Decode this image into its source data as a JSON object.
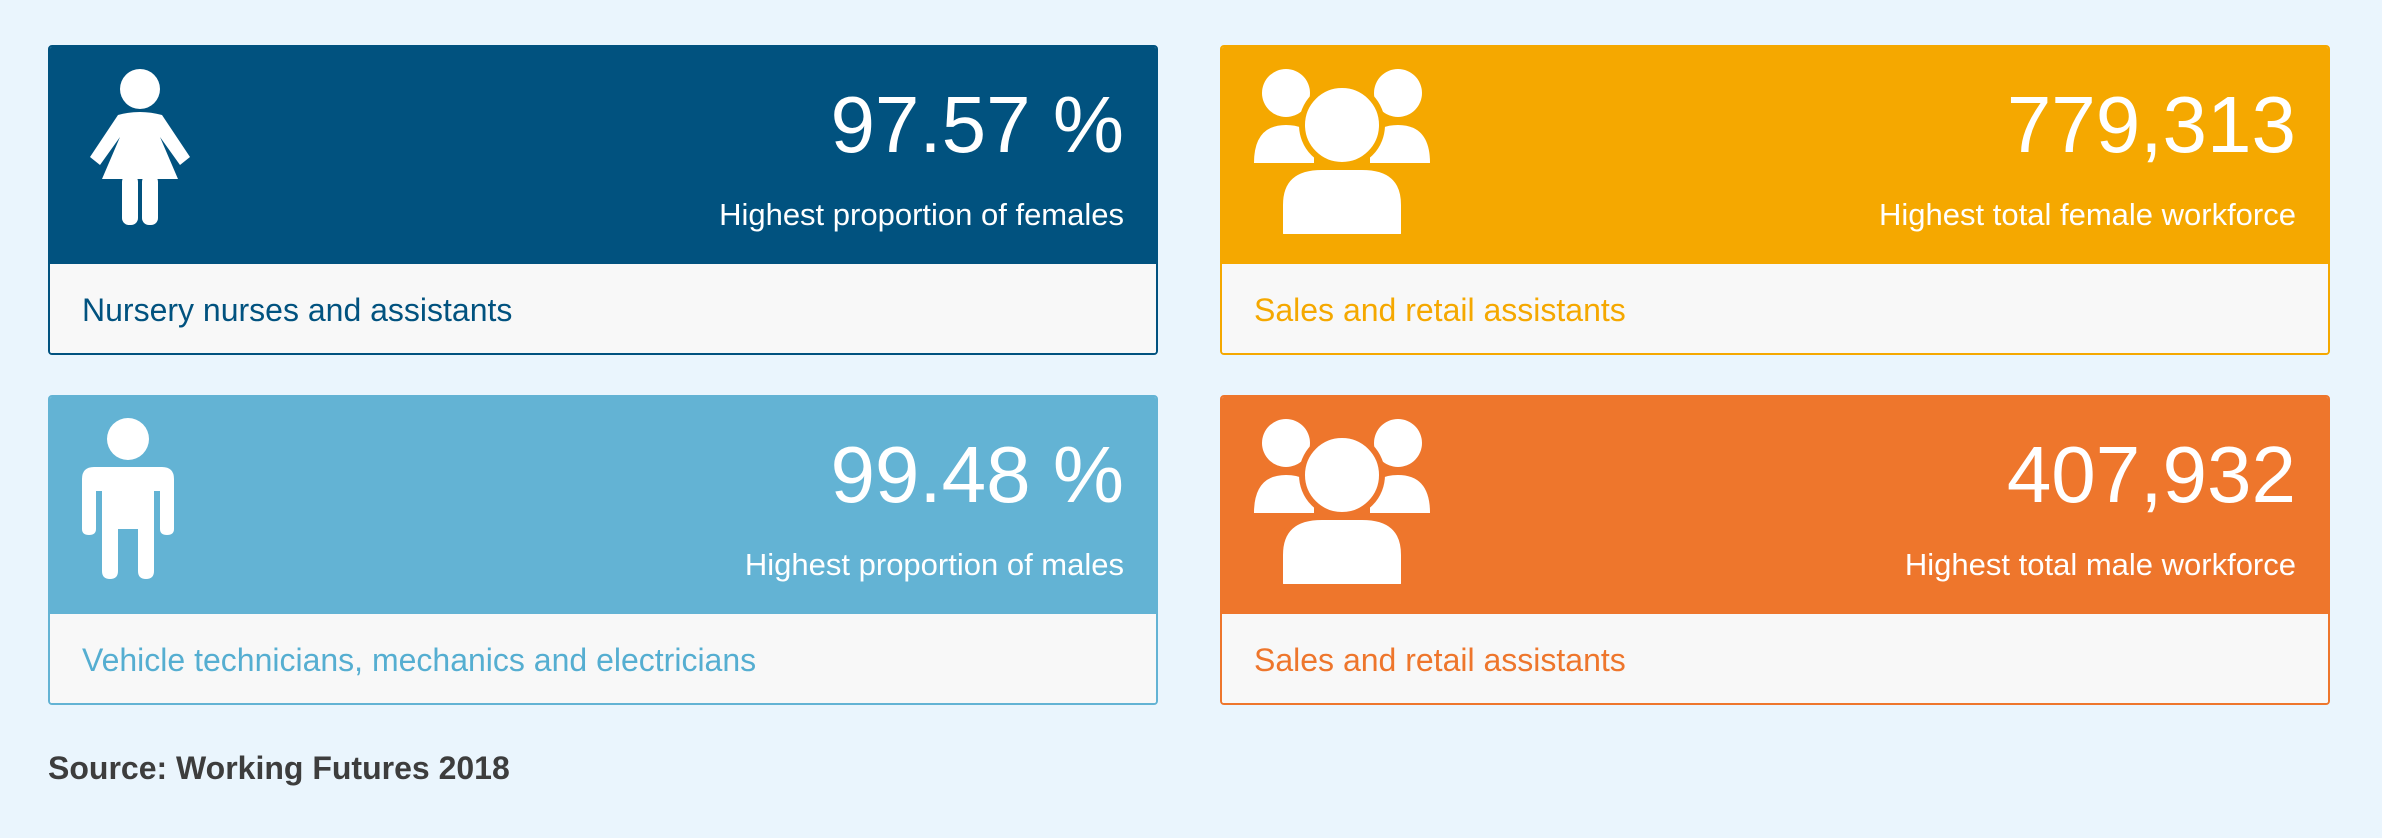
{
  "cards": [
    {
      "value": "97.57 %",
      "caption": "Highest proportion of females",
      "occupation": "Nursery nurses and assistants",
      "icon": "female-person-icon",
      "color": "#01527f"
    },
    {
      "value": "779,313",
      "caption": "Highest total female workforce",
      "occupation": "Sales and retail assistants",
      "icon": "group-of-people-icon",
      "color": "#f5a800"
    },
    {
      "value": "99.48 %",
      "caption": "Highest proportion of males",
      "occupation": "Vehicle technicians, mechanics and electricians",
      "icon": "male-person-icon",
      "color": "#63b3d4"
    },
    {
      "value": "407,932",
      "caption": "Highest total male workforce",
      "occupation": "Sales and retail assistants",
      "icon": "group-of-people-icon",
      "color": "#ee762c"
    }
  ],
  "source": "Source: Working Futures 2018"
}
